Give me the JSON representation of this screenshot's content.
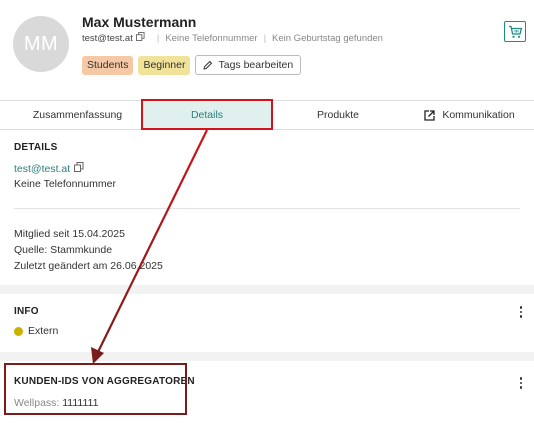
{
  "profile": {
    "avatar_initials": "MM",
    "name": "Max Mustermann",
    "email": "test@test.at",
    "phone": "Keine Telefonnummer",
    "birthday": "Kein Geburtstag gefunden",
    "tags": [
      "Students",
      "Beginner"
    ],
    "edit_tags_label": "Tags bearbeiten"
  },
  "tabs": [
    {
      "label": "Zusammenfassung"
    },
    {
      "label": "Details",
      "active": true
    },
    {
      "label": "Produkte"
    },
    {
      "label": "Kommunikation"
    }
  ],
  "details": {
    "title": "DETAILS",
    "email": "test@test.at",
    "phone": "Keine Telefonnummer",
    "member_since": "Mitglied seit 15.04.2025",
    "source": "Quelle: Stammkunde",
    "last_changed": "Zuletzt geändert am 26.06.2025"
  },
  "info": {
    "title": "INFO",
    "status": "Extern",
    "status_color": "#cbb100"
  },
  "aggregators": {
    "title": "KUNDEN-IDS VON AGGREGATOREN",
    "wellpass_label": "Wellpass:",
    "wellpass_id": "1111111"
  },
  "colors": {
    "accent": "#2a7f7a",
    "highlight_red": "#d0141a",
    "highlight_brown": "#7a1c1c"
  }
}
